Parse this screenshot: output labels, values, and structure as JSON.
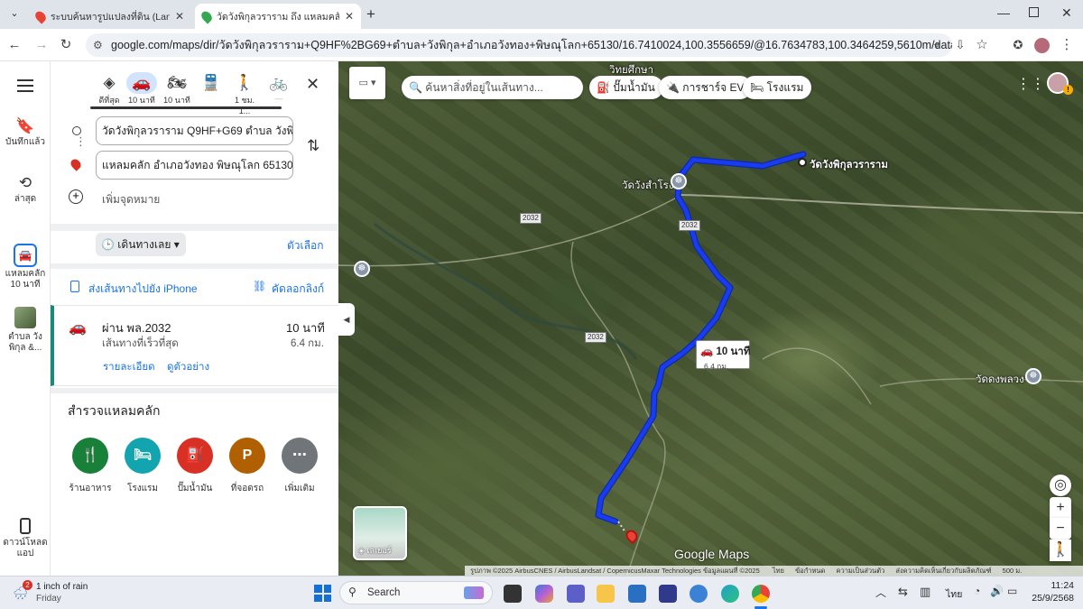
{
  "browser": {
    "tabs": [
      {
        "title": "ระบบค้นหารูปแปลงที่ดิน (LandsMap)",
        "active": false
      },
      {
        "title": "วัดวังพิกุลวราราม ถึง แหลมคลัก อำเภ",
        "active": true
      }
    ],
    "url": "google.com/maps/dir/วัดวังพิกุลวราราม+Q9HF%2BG69+ตำบล+วังพิกุล+อำเภอวังทอง+พิษณุโลก+65130/16.7410024,100.3556659/@16.7634783,100.3464259,5610m/data=!3m1!1e3!4m9!4m8!..."
  },
  "rail": {
    "items": [
      {
        "label": "บันทึกแล้ว",
        "icon": "bookmark-icon"
      },
      {
        "label": "ล่าสุด",
        "icon": "history-icon"
      },
      {
        "label": "แหลมคลัก 10 นาที",
        "icon": "car-icon"
      },
      {
        "label": "ตำบล วังพิกุล &...",
        "icon": "place-thumbnail"
      },
      {
        "label": "ดาวน์โหลดแอป",
        "icon": "phone-icon"
      }
    ]
  },
  "directions": {
    "modes": [
      {
        "label": "ดีที่สุด",
        "icon": "best-route-icon"
      },
      {
        "label": "10 นาที",
        "icon": "car-icon",
        "selected": true
      },
      {
        "label": "10 นาที",
        "icon": "motorbike-icon"
      },
      {
        "label": "",
        "icon": "transit-icon"
      },
      {
        "label": "1 ชม. 1...",
        "icon": "walk-icon"
      },
      {
        "label": "—",
        "icon": "bike-icon"
      }
    ],
    "origin": "วัดวังพิกุลวราราม Q9HF+G69 ตำบล วังพิกุล อ",
    "destination": "แหลมคลัก อำเภอวังทอง พิษณุโลก 65130",
    "add_destination": "เพิ่มจุดหมาย",
    "depart_label": "เดินทางเลย",
    "options_label": "ตัวเลือก",
    "send_to_phone": "ส่งเส้นทางไปยัง iPhone",
    "copy_link": "คัดลอกลิงก์"
  },
  "route": {
    "via": "ผ่าน พล.2032",
    "duration": "10 นาที",
    "note": "เส้นทางที่เร็วที่สุด",
    "distance": "6.4 กม.",
    "details": "รายละเอียด",
    "preview": "ดูตัวอย่าง"
  },
  "explore": {
    "title": "สำรวจแหลมคลัก",
    "items": [
      {
        "label": "ร้านอาหาร",
        "icon": "restaurant-icon",
        "color": "#188038"
      },
      {
        "label": "โรงแรม",
        "icon": "hotel-icon",
        "color": "#12a4af"
      },
      {
        "label": "ปั๊มน้ำมัน",
        "icon": "gas-station-icon",
        "color": "#d93025"
      },
      {
        "label": "ที่จอดรถ",
        "icon": "parking-icon",
        "color": "#b06000"
      },
      {
        "label": "เพิ่มเติม",
        "icon": "more-icon",
        "color": "#70757a"
      }
    ]
  },
  "map": {
    "search_placeholder": "ค้นหาสิ่งที่อยู่ในเส้นทาง...",
    "filters": [
      "ปั๊มน้ำมัน",
      "การชาร์จ EV",
      "โรงแรม"
    ],
    "route_label": {
      "duration": "10 นาที",
      "distance": "6.4 กม."
    },
    "places": [
      "วัดวังพิกุลวราราม",
      "วัดวังสำโรง",
      "วัดดงพลวง",
      "วิทยศึกษา"
    ],
    "road_numbers": [
      "2032",
      "2032",
      "2032"
    ],
    "layers_label": "เลเยอร์",
    "brand": "Google Maps",
    "attribution": "รูปภาพ ©2025 AirbusCNES / AirbusLandsat / CopernicusMaxar Technologies ข้อมูลแผนที่ ©2025",
    "footer_links": [
      "ไทย",
      "ข้อกำหนด",
      "ความเป็นส่วนตัว",
      "ส่งความคิดเห็นเกี่ยวกับผลิตภัณฑ์",
      "500 ม."
    ],
    "route_color": "#1a3cf0"
  },
  "taskbar": {
    "weather_badge": "2",
    "weather": "1 inch of rain",
    "weather_sub": "Friday",
    "search": "Search",
    "lang": "ไทย",
    "time": "11:24",
    "date": "25/9/2568"
  }
}
